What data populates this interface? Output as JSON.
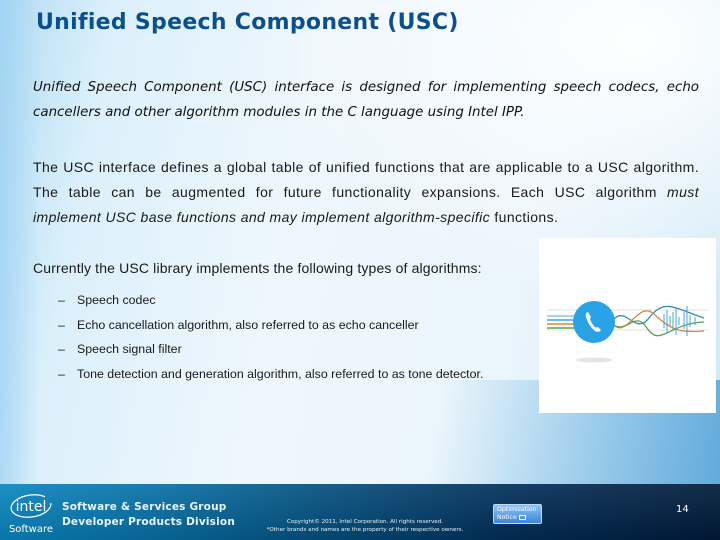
{
  "slide": {
    "title": "Unified Speech Component (USC)",
    "paragraph1": "Unified Speech Component (USC) interface is designed for implementing speech codecs, echo cancellers and other algorithm modules in the C language using Intel IPP.",
    "paragraph2": {
      "part1": "The USC interface defines a global table of unified functions that are applicable to a USC algorithm. The table can be augmented for future functionality expansions. Each USC algorithm ",
      "emphasis": "must implement USC base functions and may implement algorithm-specific",
      "part2": " functions."
    },
    "paragraph3": "Currently the USC library implements the following types of algorithms:",
    "bullet_marker": "–",
    "bullets": [
      "Speech codec",
      "Echo cancellation algorithm, also referred to as echo canceller",
      "Speech signal filter",
      "Tone detection and generation algorithm, also referred to as tone detector."
    ],
    "illustration": {
      "icon": "phone-icon",
      "description": "phone-with-signal-waves",
      "colors": {
        "circle": "#2aa3e6",
        "wave_blue": "#3fa9e0",
        "wave_orange": "#e8843a",
        "wave_green": "#5aa04a",
        "wave_teal": "#2f8fb0"
      }
    }
  },
  "footer": {
    "logo_text": "intel",
    "logo_sub": "Software",
    "group_line1": "Software & Services Group",
    "group_line2": "Developer Products Division",
    "copyright_line1": "Copyright© 2011, Intel Corporation. All rights reserved.",
    "copyright_line2": "*Other brands and names are the property of their respective owners.",
    "optimization_notice_line1": "Optimization",
    "optimization_notice_line2": "Notice",
    "page_number": "14"
  },
  "colors": {
    "title": "#0b4f8c",
    "footer_left": "#0a86c0",
    "footer_right": "#011a3a"
  }
}
